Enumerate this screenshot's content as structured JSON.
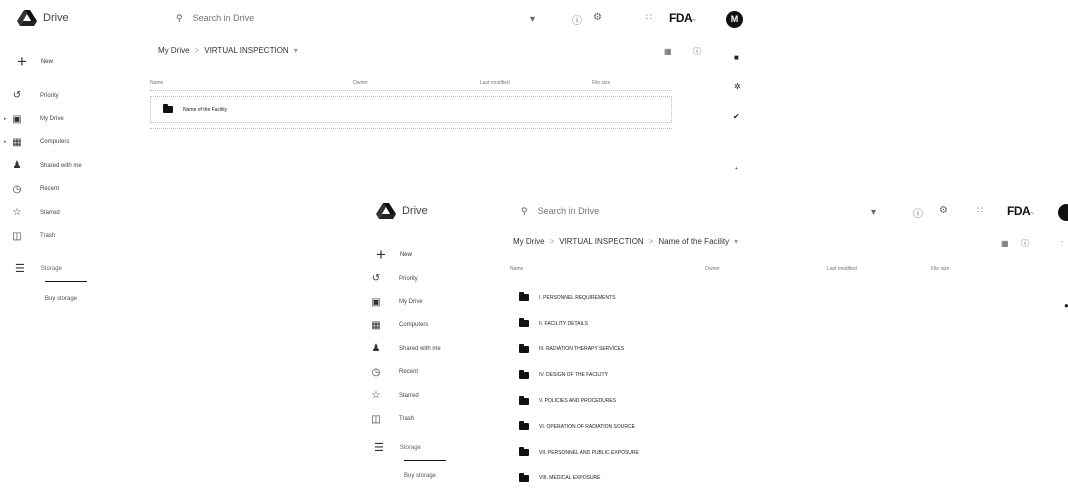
{
  "screen1": {
    "brand": "Drive",
    "search_placeholder": "Search in Drive",
    "fda_logo": "FDA",
    "avatar_letter": "M",
    "new_label": "New",
    "nav": [
      {
        "label": "Priority",
        "icon": "priority-icon"
      },
      {
        "label": "My Drive",
        "icon": "my-drive-icon"
      },
      {
        "label": "Computers",
        "icon": "computers-icon"
      },
      {
        "label": "Shared with me",
        "icon": "shared-icon"
      },
      {
        "label": "Recent",
        "icon": "recent-icon"
      },
      {
        "label": "Starred",
        "icon": "star-icon"
      },
      {
        "label": "Trash",
        "icon": "trash-icon"
      }
    ],
    "storage_label": "Storage",
    "storage_used": "",
    "buy_storage": "Buy storage",
    "breadcrumb": [
      "My Drive",
      "VIRTUAL INSPECTION"
    ],
    "columns": {
      "name": "Name",
      "owner": "Owner",
      "modified": "Last modified",
      "size": "File size"
    },
    "rows": [
      {
        "name": "Name of the Facility",
        "owner": "",
        "modified": "",
        "size": ""
      }
    ]
  },
  "screen2": {
    "brand": "Drive",
    "search_placeholder": "Search in Drive",
    "fda_logo": "FDA",
    "new_label": "New",
    "nav": [
      {
        "label": "Priority",
        "icon": "priority-icon"
      },
      {
        "label": "My Drive",
        "icon": "my-drive-icon"
      },
      {
        "label": "Computers",
        "icon": "computers-icon"
      },
      {
        "label": "Shared with me",
        "icon": "shared-icon"
      },
      {
        "label": "Recent",
        "icon": "recent-icon"
      },
      {
        "label": "Starred",
        "icon": "star-icon"
      },
      {
        "label": "Trash",
        "icon": "trash-icon"
      }
    ],
    "storage_label": "Storage",
    "storage_used": "",
    "buy_storage": "Buy storage",
    "breadcrumb": [
      "My Drive",
      "VIRTUAL INSPECTION",
      "Name of the Facility"
    ],
    "columns": {
      "name": "Name",
      "owner": "Owner",
      "modified": "Last modified",
      "size": "File size"
    },
    "rows": [
      {
        "name": "I. PERSONNEL REQUIREMENTS",
        "owner": "",
        "modified": "",
        "size": ""
      },
      {
        "name": "II. FACILITY DETAILS",
        "owner": "",
        "modified": "",
        "size": ""
      },
      {
        "name": "III. RADIATION THERAPY SERVICES",
        "owner": "",
        "modified": "",
        "size": ""
      },
      {
        "name": "IV. DESIGN OF THE FACILITY",
        "owner": "",
        "modified": "",
        "size": ""
      },
      {
        "name": "V. POLICIES AND PROCEDURES",
        "owner": "",
        "modified": "",
        "size": ""
      },
      {
        "name": "VI. OPERATION OF RADIATION SOURCE",
        "owner": "",
        "modified": "",
        "size": ""
      },
      {
        "name": "VII. PERSONNEL AND PUBLIC EXPOSURE",
        "owner": "",
        "modified": "",
        "size": ""
      },
      {
        "name": "VIII. MEDICAL EXPOSURE",
        "owner": "",
        "modified": "",
        "size": ""
      }
    ]
  },
  "colors": {
    "ink": "#111111",
    "muted": "#999999"
  }
}
